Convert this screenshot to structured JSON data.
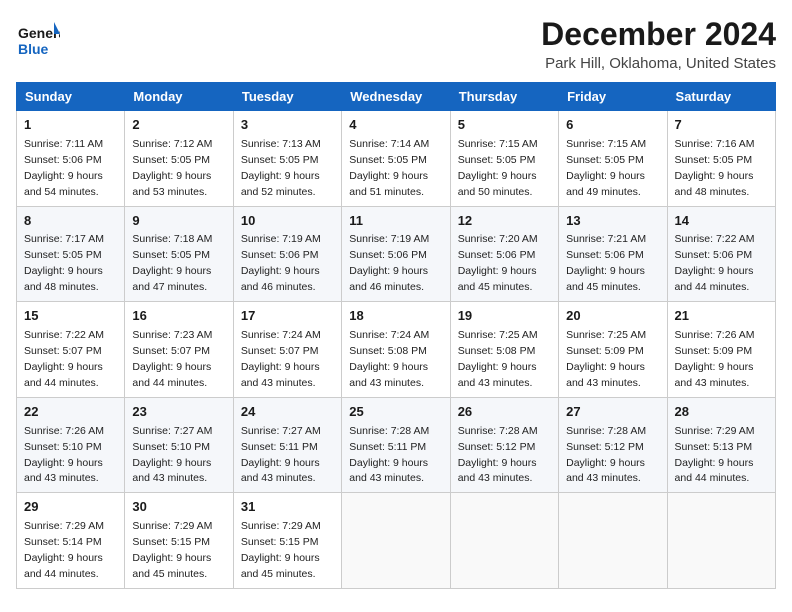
{
  "header": {
    "logo_line1": "General",
    "logo_line2": "Blue",
    "title": "December 2024",
    "subtitle": "Park Hill, Oklahoma, United States"
  },
  "calendar": {
    "headers": [
      "Sunday",
      "Monday",
      "Tuesday",
      "Wednesday",
      "Thursday",
      "Friday",
      "Saturday"
    ],
    "weeks": [
      [
        {
          "day": "1",
          "sunrise": "7:11 AM",
          "sunset": "5:06 PM",
          "daylight": "9 hours and 54 minutes."
        },
        {
          "day": "2",
          "sunrise": "7:12 AM",
          "sunset": "5:05 PM",
          "daylight": "9 hours and 53 minutes."
        },
        {
          "day": "3",
          "sunrise": "7:13 AM",
          "sunset": "5:05 PM",
          "daylight": "9 hours and 52 minutes."
        },
        {
          "day": "4",
          "sunrise": "7:14 AM",
          "sunset": "5:05 PM",
          "daylight": "9 hours and 51 minutes."
        },
        {
          "day": "5",
          "sunrise": "7:15 AM",
          "sunset": "5:05 PM",
          "daylight": "9 hours and 50 minutes."
        },
        {
          "day": "6",
          "sunrise": "7:15 AM",
          "sunset": "5:05 PM",
          "daylight": "9 hours and 49 minutes."
        },
        {
          "day": "7",
          "sunrise": "7:16 AM",
          "sunset": "5:05 PM",
          "daylight": "9 hours and 48 minutes."
        }
      ],
      [
        {
          "day": "8",
          "sunrise": "7:17 AM",
          "sunset": "5:05 PM",
          "daylight": "9 hours and 48 minutes."
        },
        {
          "day": "9",
          "sunrise": "7:18 AM",
          "sunset": "5:05 PM",
          "daylight": "9 hours and 47 minutes."
        },
        {
          "day": "10",
          "sunrise": "7:19 AM",
          "sunset": "5:06 PM",
          "daylight": "9 hours and 46 minutes."
        },
        {
          "day": "11",
          "sunrise": "7:19 AM",
          "sunset": "5:06 PM",
          "daylight": "9 hours and 46 minutes."
        },
        {
          "day": "12",
          "sunrise": "7:20 AM",
          "sunset": "5:06 PM",
          "daylight": "9 hours and 45 minutes."
        },
        {
          "day": "13",
          "sunrise": "7:21 AM",
          "sunset": "5:06 PM",
          "daylight": "9 hours and 45 minutes."
        },
        {
          "day": "14",
          "sunrise": "7:22 AM",
          "sunset": "5:06 PM",
          "daylight": "9 hours and 44 minutes."
        }
      ],
      [
        {
          "day": "15",
          "sunrise": "7:22 AM",
          "sunset": "5:07 PM",
          "daylight": "9 hours and 44 minutes."
        },
        {
          "day": "16",
          "sunrise": "7:23 AM",
          "sunset": "5:07 PM",
          "daylight": "9 hours and 44 minutes."
        },
        {
          "day": "17",
          "sunrise": "7:24 AM",
          "sunset": "5:07 PM",
          "daylight": "9 hours and 43 minutes."
        },
        {
          "day": "18",
          "sunrise": "7:24 AM",
          "sunset": "5:08 PM",
          "daylight": "9 hours and 43 minutes."
        },
        {
          "day": "19",
          "sunrise": "7:25 AM",
          "sunset": "5:08 PM",
          "daylight": "9 hours and 43 minutes."
        },
        {
          "day": "20",
          "sunrise": "7:25 AM",
          "sunset": "5:09 PM",
          "daylight": "9 hours and 43 minutes."
        },
        {
          "day": "21",
          "sunrise": "7:26 AM",
          "sunset": "5:09 PM",
          "daylight": "9 hours and 43 minutes."
        }
      ],
      [
        {
          "day": "22",
          "sunrise": "7:26 AM",
          "sunset": "5:10 PM",
          "daylight": "9 hours and 43 minutes."
        },
        {
          "day": "23",
          "sunrise": "7:27 AM",
          "sunset": "5:10 PM",
          "daylight": "9 hours and 43 minutes."
        },
        {
          "day": "24",
          "sunrise": "7:27 AM",
          "sunset": "5:11 PM",
          "daylight": "9 hours and 43 minutes."
        },
        {
          "day": "25",
          "sunrise": "7:28 AM",
          "sunset": "5:11 PM",
          "daylight": "9 hours and 43 minutes."
        },
        {
          "day": "26",
          "sunrise": "7:28 AM",
          "sunset": "5:12 PM",
          "daylight": "9 hours and 43 minutes."
        },
        {
          "day": "27",
          "sunrise": "7:28 AM",
          "sunset": "5:12 PM",
          "daylight": "9 hours and 43 minutes."
        },
        {
          "day": "28",
          "sunrise": "7:29 AM",
          "sunset": "5:13 PM",
          "daylight": "9 hours and 44 minutes."
        }
      ],
      [
        {
          "day": "29",
          "sunrise": "7:29 AM",
          "sunset": "5:14 PM",
          "daylight": "9 hours and 44 minutes."
        },
        {
          "day": "30",
          "sunrise": "7:29 AM",
          "sunset": "5:15 PM",
          "daylight": "9 hours and 45 minutes."
        },
        {
          "day": "31",
          "sunrise": "7:29 AM",
          "sunset": "5:15 PM",
          "daylight": "9 hours and 45 minutes."
        },
        null,
        null,
        null,
        null
      ]
    ]
  }
}
